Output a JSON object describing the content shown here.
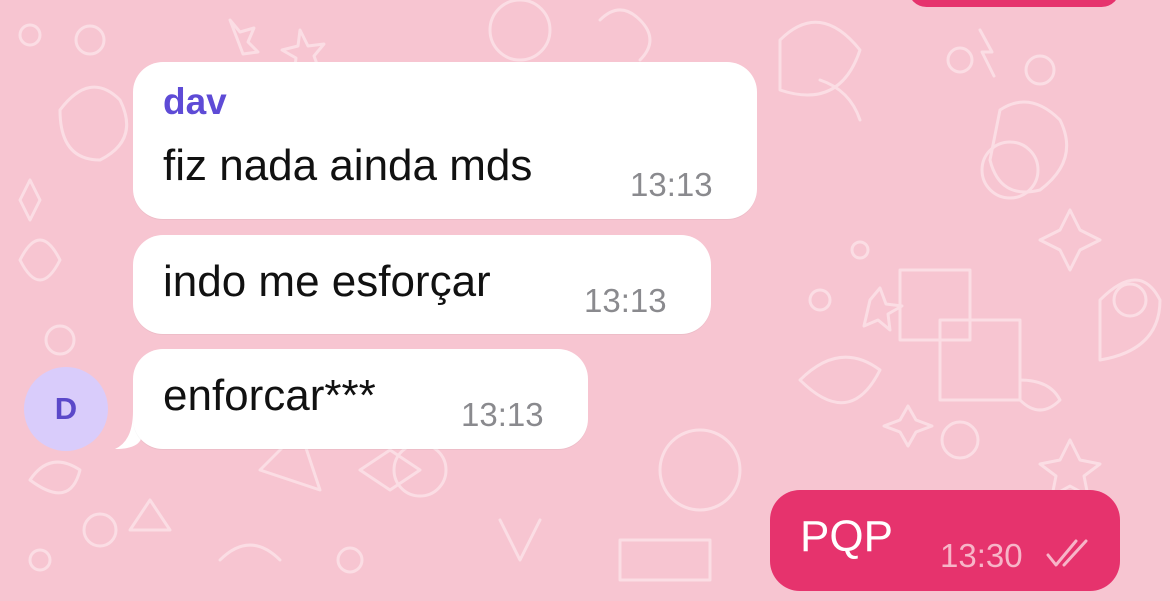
{
  "theme": {
    "wallpaper_color": "#F7C5D1",
    "incoming_bubble": "#FFFFFF",
    "outgoing_bubble": "#E6336D",
    "sender_name_color": "#5E4BD6",
    "avatar_bg": "#D9CCFB",
    "avatar_fg": "#5B48C9"
  },
  "chat": {
    "incoming_group": {
      "sender": "dav",
      "avatar_initial": "D",
      "messages": [
        {
          "text": "fiz nada ainda mds",
          "time": "13:13"
        },
        {
          "text": "indo me esforçar",
          "time": "13:13"
        },
        {
          "text": "enforcar***",
          "time": "13:13"
        }
      ]
    },
    "outgoing": {
      "text": "PQP",
      "time": "13:30",
      "status_icon": "double-check-read-icon"
    }
  }
}
